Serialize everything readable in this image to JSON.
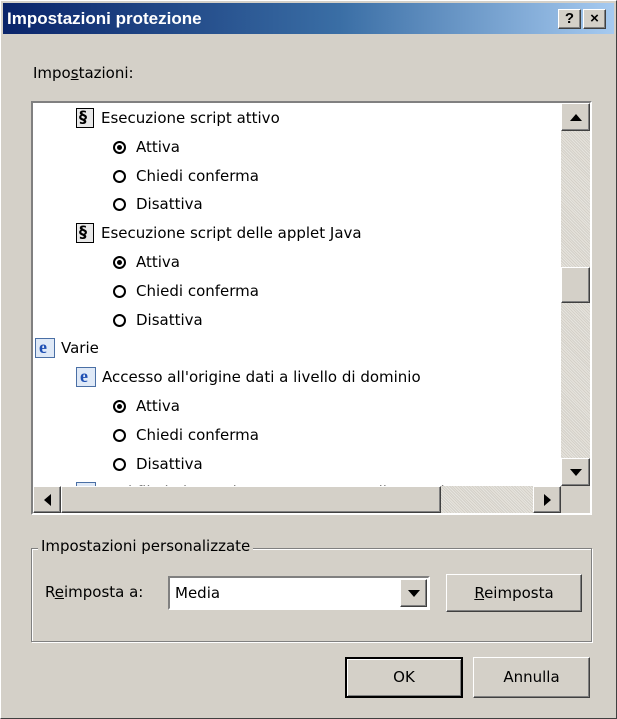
{
  "dialog": {
    "title": "Impostazioni protezione",
    "help_button": "?",
    "close_button": "×"
  },
  "settings_label": {
    "before": "Impo",
    "mnemonic": "s",
    "after": "tazioni:"
  },
  "settings_list": [
    {
      "kind": "category",
      "icon": "script-icon",
      "text": "Esecuzione script attivo"
    },
    {
      "kind": "option",
      "text": "Attiva",
      "selected": true
    },
    {
      "kind": "option",
      "text": "Chiedi conferma",
      "selected": false
    },
    {
      "kind": "option",
      "text": "Disattiva",
      "selected": false
    },
    {
      "kind": "category",
      "icon": "script-icon",
      "text": "Esecuzione script delle applet Java"
    },
    {
      "kind": "option",
      "text": "Attiva",
      "selected": true
    },
    {
      "kind": "option",
      "text": "Chiedi conferma",
      "selected": false
    },
    {
      "kind": "option",
      "text": "Disattiva",
      "selected": false
    },
    {
      "kind": "group",
      "icon": "ie-document-icon",
      "text": "Varie"
    },
    {
      "kind": "category",
      "icon": "ie-document-icon",
      "text": "Accesso all'origine dati a livello di dominio"
    },
    {
      "kind": "option",
      "text": "Attiva",
      "selected": true
    },
    {
      "kind": "option",
      "text": "Chiedi conferma",
      "selected": false
    },
    {
      "kind": "option",
      "text": "Disattiva",
      "selected": false
    },
    {
      "kind": "category",
      "icon": "ie-document-icon",
      "text": "Apri file in base al contenuto e non all'estensione"
    }
  ],
  "custom_settings": {
    "legend": "Impostazioni personalizzate",
    "reset_to_label": {
      "before": "R",
      "mnemonic": "e",
      "after": "imposta a:"
    },
    "reset_to_value": "Media",
    "reset_button": {
      "before": "",
      "mnemonic": "R",
      "after": "eimposta"
    }
  },
  "buttons": {
    "ok": "OK",
    "cancel": "Annulla"
  },
  "colors": {
    "face": "#d4d0c8",
    "title_start": "#0a246a",
    "title_end": "#a6caf0"
  }
}
